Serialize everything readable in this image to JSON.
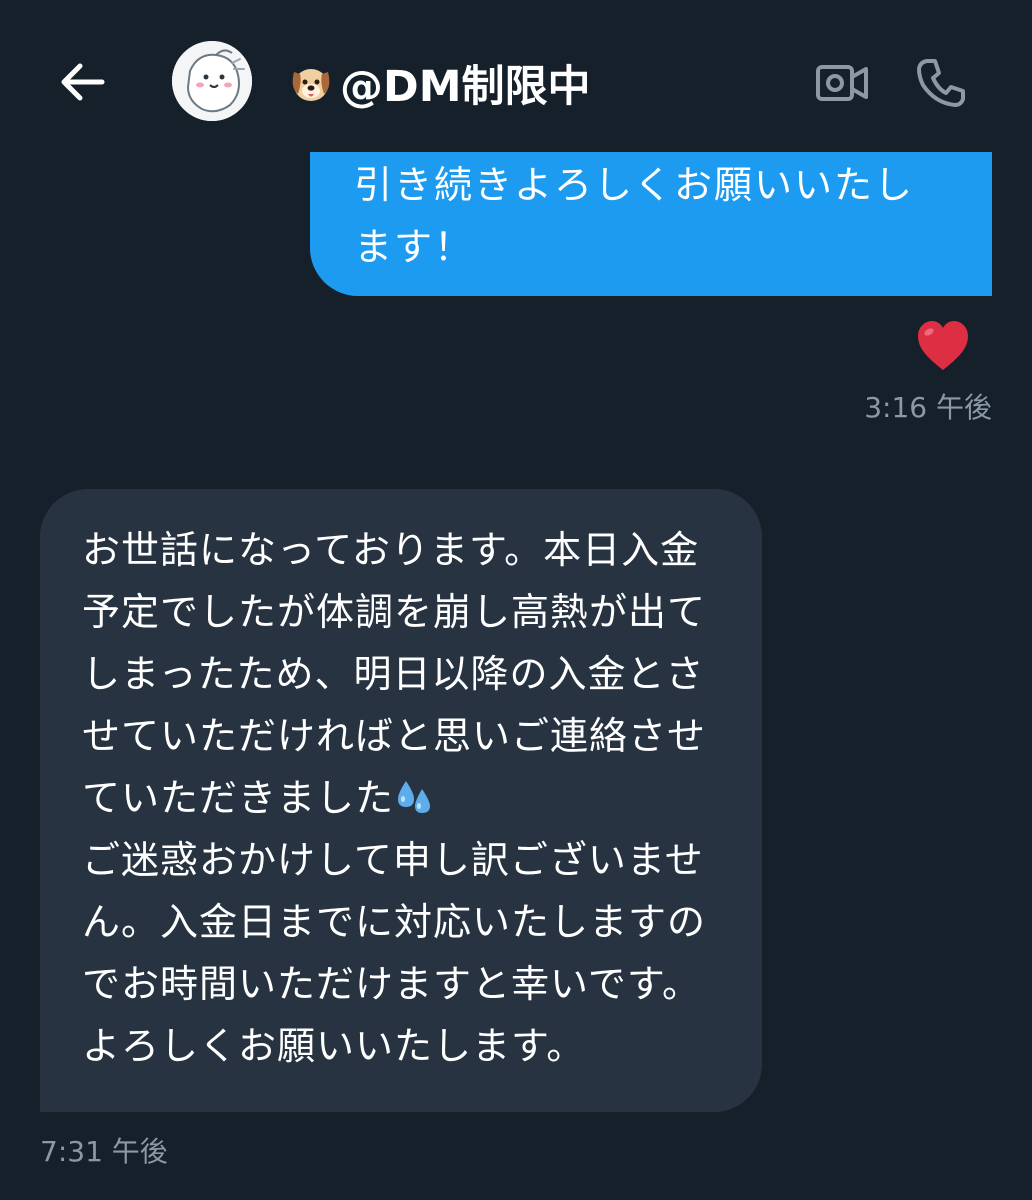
{
  "header": {
    "back_icon": "arrow-left-icon",
    "avatar_icon": "avatar-image",
    "title_emoji_icon": "dog-face-icon",
    "title": "@DM制限中",
    "video_icon": "video-camera-icon",
    "phone_icon": "phone-icon"
  },
  "messages": {
    "sent": {
      "text": "引き続きよろしくお願いいたします！",
      "reaction_icon": "red-heart-icon",
      "time": "3:16 午後"
    },
    "received": {
      "lines": [
        "お世話になっております。本日入金",
        "予定でしたが体調を崩し高熱が出て",
        "しまったため、明日以降の入金とさ",
        "せていただければと思いご連絡させ",
        "ていただきました",
        "ご迷惑おかけして申し訳ございませ",
        "ん。入金日までに対応いたしますの",
        "でお時間いただけますと幸いです。",
        "よろしくお願いいたします。"
      ],
      "inline_emoji_icon": "sweat-droplets-icon",
      "time": "7:31 午後"
    }
  },
  "colors": {
    "background": "#15202b",
    "sent_bubble": "#1d9bf0",
    "received_bubble": "#273340",
    "timestamp": "#8b98a5",
    "header_icon": "#ffffff"
  }
}
